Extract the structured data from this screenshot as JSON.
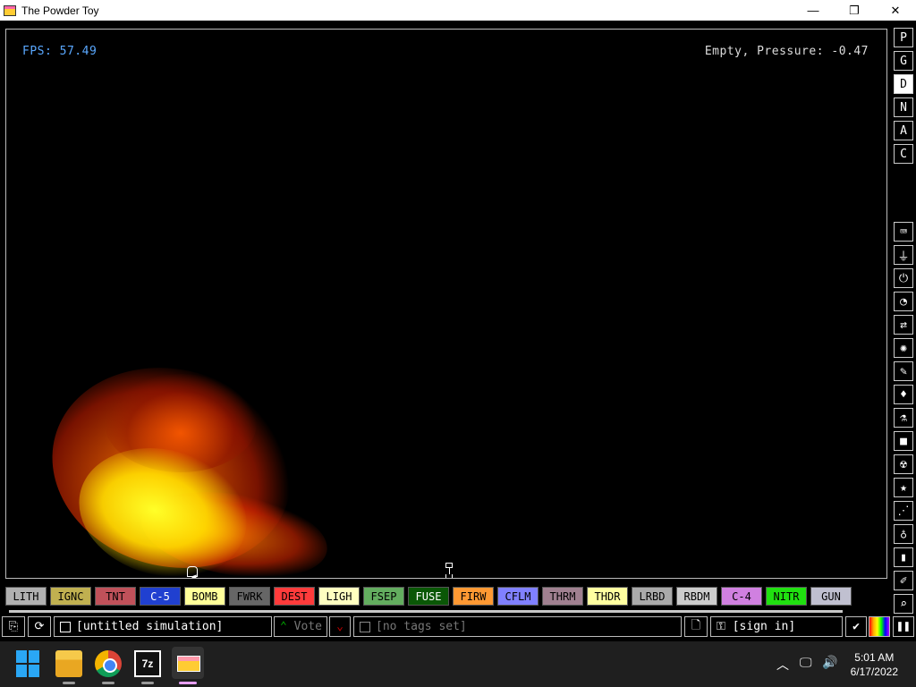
{
  "window": {
    "title": "The Powder Toy",
    "minimize_glyph": "—",
    "maximize_glyph": "❐",
    "close_glyph": "✕"
  },
  "hud": {
    "fps": "FPS: 57.49",
    "status": "Empty, Pressure: -0.47"
  },
  "side_menu": [
    {
      "label": "P"
    },
    {
      "label": "G"
    },
    {
      "label": "D",
      "active": true
    },
    {
      "label": "N"
    },
    {
      "label": "A"
    },
    {
      "label": "C"
    }
  ],
  "side_icons": [
    "keyboard-icon",
    "plug-icon",
    "power-icon",
    "gauge-icon",
    "arrows-icon",
    "explosive-icon",
    "wand-icon",
    "drop-icon",
    "flask-icon",
    "square-icon",
    "radiation-icon",
    "star-icon",
    "dots-icon",
    "bulb-icon",
    "bookmark-icon",
    "edit-icon",
    "search-icon"
  ],
  "elements": [
    {
      "label": "LITH",
      "bg": "#b0b0b0",
      "fg": "#000000"
    },
    {
      "label": "IGNC",
      "bg": "#c0b050",
      "fg": "#000000"
    },
    {
      "label": "TNT",
      "bg": "#c0515a",
      "fg": "#000000"
    },
    {
      "label": "C-5",
      "bg": "#2040d0",
      "fg": "#ffffff"
    },
    {
      "label": "BOMB",
      "bg": "#ffff99",
      "fg": "#000000"
    },
    {
      "label": "FWRK",
      "bg": "#666666",
      "fg": "#000000"
    },
    {
      "label": "DEST",
      "bg": "#ff3b3b",
      "fg": "#000000"
    },
    {
      "label": "LIGH",
      "bg": "#ffffc0",
      "fg": "#000000"
    },
    {
      "label": "FSEP",
      "bg": "#63ad5f",
      "fg": "#000000"
    },
    {
      "label": "FUSE",
      "bg": "#0a5706",
      "fg": "#ffffff"
    },
    {
      "label": "FIRW",
      "bg": "#ff9933",
      "fg": "#000000"
    },
    {
      "label": "CFLM",
      "bg": "#8080ff",
      "fg": "#000000"
    },
    {
      "label": "THRM",
      "bg": "#a08090",
      "fg": "#000000"
    },
    {
      "label": "THDR",
      "bg": "#ffffa0",
      "fg": "#000000"
    },
    {
      "label": "LRBD",
      "bg": "#aaaaaa",
      "fg": "#000000"
    },
    {
      "label": "RBDM",
      "bg": "#cccccc",
      "fg": "#000000"
    },
    {
      "label": "C-4",
      "bg": "#d080e0",
      "fg": "#000000"
    },
    {
      "label": "NITR",
      "bg": "#20e010",
      "fg": "#000000"
    },
    {
      "label": "GUN",
      "bg": "#c0c0d0",
      "fg": "#000000"
    }
  ],
  "bottom": {
    "save_name": "[untitled simulation]",
    "vote": "Vote",
    "tags": "[no tags set]",
    "sign_in": "[sign in]"
  },
  "taskbar": {
    "sevenzip_label": "7z",
    "time": "5:01 AM",
    "date": "6/17/2022"
  }
}
